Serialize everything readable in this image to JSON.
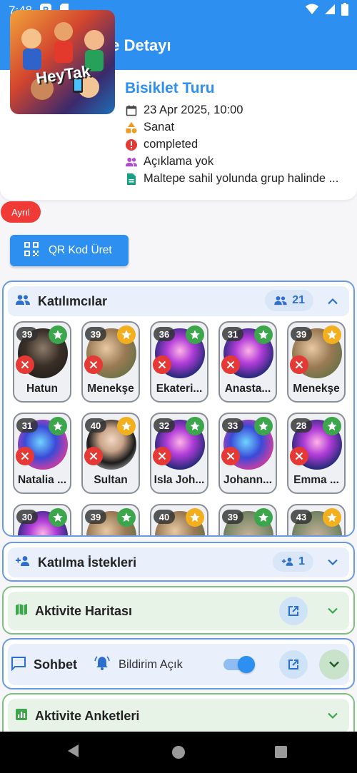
{
  "status_bar": {
    "time": "7:48"
  },
  "app_bar": {
    "title": "Aktivite Detayı"
  },
  "activity": {
    "image_logo_text": "HeyTak",
    "title": "Bisiklet Turu",
    "datetime": "23 Apr 2025, 10:00",
    "category": "Sanat",
    "status": "completed",
    "description": "Açıklama yok",
    "location": "Maltepe sahil yolunda grup halinde ..."
  },
  "leave_badge": "Ayrıl",
  "qr_button": "QR Kod Üret",
  "participants_section": {
    "title": "Katılımcılar",
    "count": "21",
    "participants": [
      {
        "age": "39",
        "name": "Hatun",
        "star": "green",
        "avatar": "dark"
      },
      {
        "age": "39",
        "name": "Menekşe",
        "star": "gold",
        "avatar": "dog"
      },
      {
        "age": "36",
        "name": "Ekateri...",
        "star": "green",
        "avatar": "neon"
      },
      {
        "age": "31",
        "name": "Anasta...",
        "star": "green",
        "avatar": "neon"
      },
      {
        "age": "39",
        "name": "Menekşe",
        "star": "gold",
        "avatar": "dog"
      },
      {
        "age": "31",
        "name": "Natalia ...",
        "star": "green",
        "avatar": "neonb"
      },
      {
        "age": "40",
        "name": "Sultan",
        "star": "gold",
        "avatar": "woman"
      },
      {
        "age": "32",
        "name": "Isla Joh...",
        "star": "green",
        "avatar": "neon"
      },
      {
        "age": "33",
        "name": "Johann...",
        "star": "green",
        "avatar": "neonb"
      },
      {
        "age": "28",
        "name": "Emma ...",
        "star": "green",
        "avatar": "neon"
      },
      {
        "age": "30",
        "name": "",
        "star": "green",
        "avatar": "neon"
      },
      {
        "age": "39",
        "name": "",
        "star": "green",
        "avatar": "dog"
      },
      {
        "age": "40",
        "name": "",
        "star": "gold",
        "avatar": "dog"
      },
      {
        "age": "39",
        "name": "",
        "star": "green",
        "avatar": "photo"
      },
      {
        "age": "43",
        "name": "",
        "star": "gold",
        "avatar": "photo"
      }
    ]
  },
  "requests_section": {
    "title": "Katılma İstekleri",
    "count": "1"
  },
  "map_section": {
    "title": "Aktivite Haritası"
  },
  "chat_section": {
    "title": "Sohbet",
    "notification_label": "Bildirim Açık",
    "notification_on": true
  },
  "polls_section": {
    "title": "Aktivite Anketleri"
  },
  "colors": {
    "primary": "#2d8ff0",
    "danger": "#e53935",
    "success": "#3ba64c",
    "gold": "#f2b01e"
  }
}
